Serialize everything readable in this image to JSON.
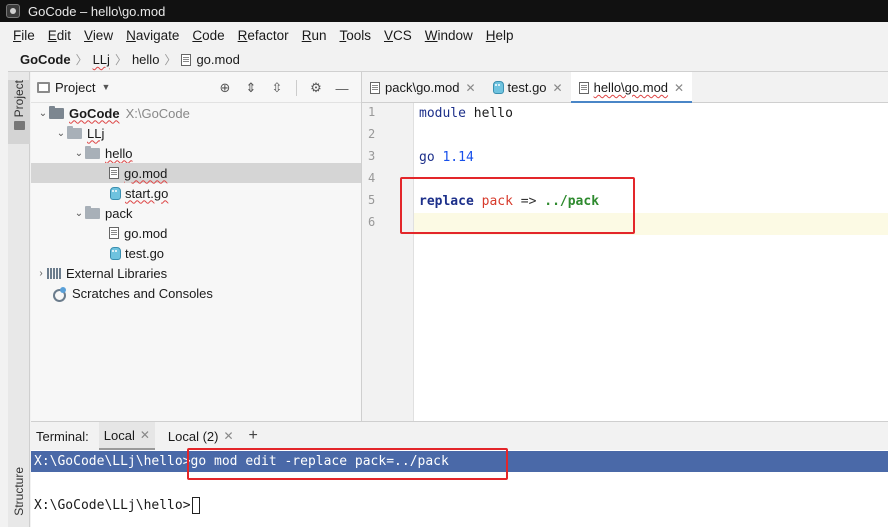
{
  "window": {
    "title": "GoCode – hello\\go.mod"
  },
  "menu": [
    "File",
    "Edit",
    "View",
    "Navigate",
    "Code",
    "Refactor",
    "Run",
    "Tools",
    "VCS",
    "Window",
    "Help"
  ],
  "breadcrumb": [
    "GoCode",
    "LLj",
    "hello",
    "go.mod"
  ],
  "project_panel": {
    "title": "Project",
    "tree": [
      {
        "label": "GoCode",
        "hint": "X:\\GoCode",
        "depth": 0,
        "kind": "folder-root",
        "expanded": true
      },
      {
        "label": "LLj",
        "depth": 1,
        "kind": "folder",
        "expanded": true
      },
      {
        "label": "hello",
        "depth": 2,
        "kind": "folder",
        "expanded": true
      },
      {
        "label": "go.mod",
        "depth": 3,
        "kind": "mod",
        "selected": true
      },
      {
        "label": "start.go",
        "depth": 3,
        "kind": "go"
      },
      {
        "label": "pack",
        "depth": 2,
        "kind": "folder",
        "expanded": true
      },
      {
        "label": "go.mod",
        "depth": 3,
        "kind": "mod"
      },
      {
        "label": "test.go",
        "depth": 3,
        "kind": "go"
      },
      {
        "label": "External Libraries",
        "depth": 0,
        "kind": "lib",
        "expanded": false
      },
      {
        "label": "Scratches and Consoles",
        "depth": 0,
        "kind": "scratch"
      }
    ]
  },
  "side_strip": {
    "project_label": "Project",
    "structure_label": "Structure"
  },
  "editor_tabs": [
    {
      "label": "pack\\go.mod",
      "icon": "file-icon",
      "active": false
    },
    {
      "label": "test.go",
      "icon": "go-file-icon",
      "active": false
    },
    {
      "label": "hello\\go.mod",
      "icon": "file-icon",
      "active": true
    }
  ],
  "editor": {
    "line_numbers": [
      "1",
      "2",
      "3",
      "4",
      "5",
      "6"
    ],
    "lines": {
      "l1_kw": "module",
      "l1_rest": " hello",
      "l3_kw": "go",
      "l3_num": " 1.14",
      "l5_kw": "replace",
      "l5_mod": " pack",
      "l5_op": " => ",
      "l5_path": "../pack"
    }
  },
  "terminal": {
    "label": "Terminal:",
    "tabs": [
      {
        "label": "Local",
        "active": true
      },
      {
        "label": "Local (2)",
        "active": false
      }
    ],
    "add": "+",
    "line1_prompt": "X:\\GoCode\\LLj\\hello>",
    "line1_cmd": "go mod edit -replace pack=../pack",
    "line2_prompt": "X:\\GoCode\\LLj\\hello>"
  },
  "colors": {
    "highlight_box": "#e3262a",
    "terminal_selection": "#4a69a8",
    "active_tab_underline": "#4a86c7"
  }
}
